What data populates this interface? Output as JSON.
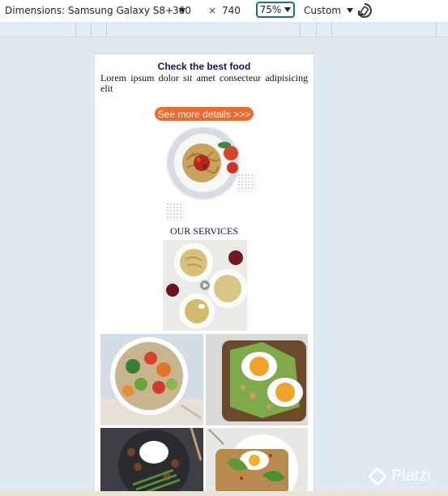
{
  "toolbar": {
    "dimensions_label": "Dimensions: Samsung Galaxy S8+",
    "width_value": "360",
    "times_sign": "×",
    "height_value": "740",
    "zoom_value": "75%",
    "throttle_value": "Custom",
    "rotate_icon": "rotate-icon"
  },
  "page": {
    "headline": "Check the best food",
    "lorem": "Lorem ipsum dolor sit amet consecteur adipisicing elit",
    "cta_label": "See more details >>>",
    "services_title": "OUR SERVICES"
  },
  "colors": {
    "cta": "#ef6a2c",
    "heading": "#13135e",
    "zoom_border": "#1f6b8a",
    "canvas_bg": "#dfe9ef"
  },
  "watermark": {
    "text": "Platzi",
    "icon": "platzi-logo-icon"
  }
}
